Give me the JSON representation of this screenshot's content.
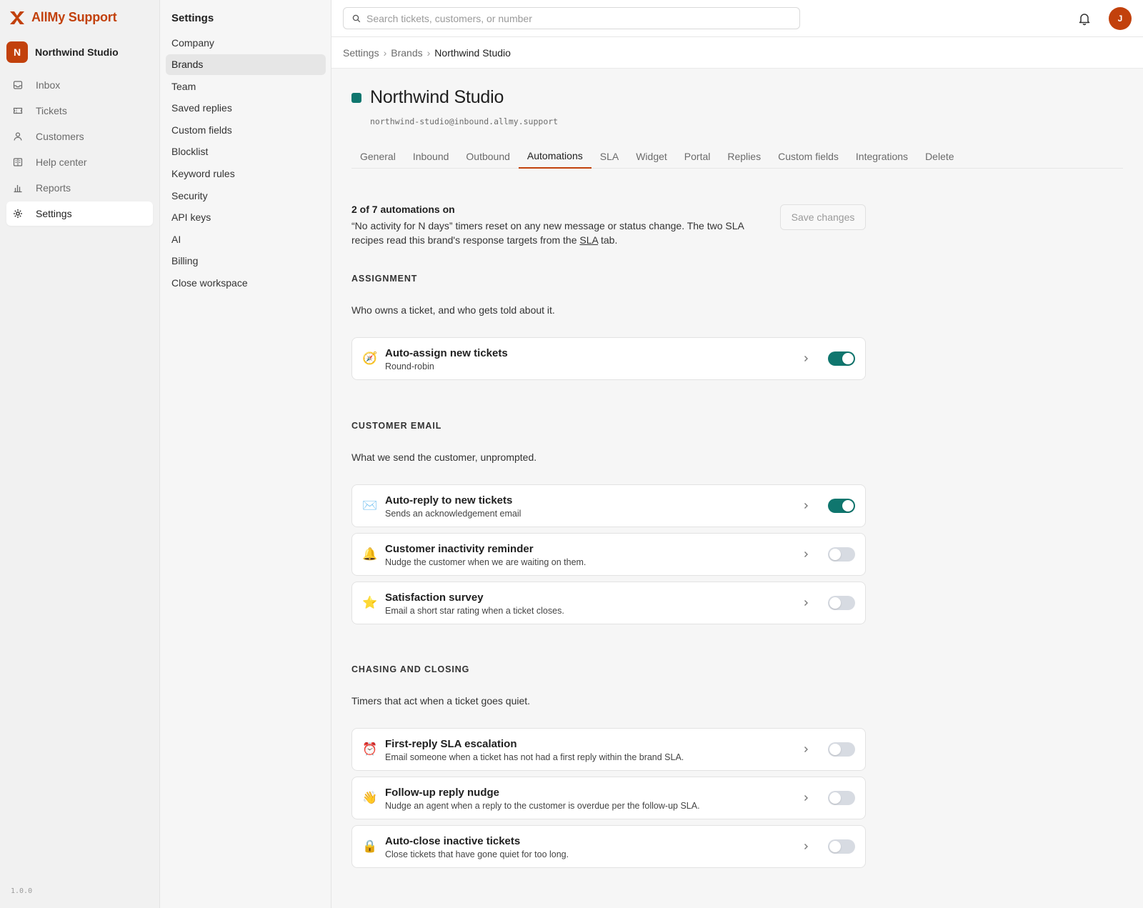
{
  "app": {
    "name": "AllMy Support",
    "version": "1.0.0",
    "brand_color": "#c2410c"
  },
  "workspace": {
    "initial": "N",
    "name": "Northwind Studio"
  },
  "nav": [
    {
      "label": "Inbox",
      "icon": "inbox-icon"
    },
    {
      "label": "Tickets",
      "icon": "ticket-icon"
    },
    {
      "label": "Customers",
      "icon": "user-icon"
    },
    {
      "label": "Help center",
      "icon": "book-icon"
    },
    {
      "label": "Reports",
      "icon": "bar-chart-icon"
    },
    {
      "label": "Settings",
      "icon": "gear-icon",
      "active": true
    }
  ],
  "settings_menu": {
    "title": "Settings",
    "items": [
      "Company",
      "Brands",
      "Team",
      "Saved replies",
      "Custom fields",
      "Blocklist",
      "Keyword rules",
      "Security",
      "API keys",
      "AI",
      "Billing",
      "Close workspace"
    ],
    "active": "Brands"
  },
  "search": {
    "placeholder": "Search tickets, customers, or number"
  },
  "user": {
    "initial": "J"
  },
  "breadcrumb": [
    "Settings",
    "Brands",
    "Northwind Studio"
  ],
  "brand": {
    "name": "Northwind Studio",
    "email": "northwind-studio@inbound.allmy.support",
    "color": "#0f766e"
  },
  "tabs": [
    "General",
    "Inbound",
    "Outbound",
    "Automations",
    "SLA",
    "Widget",
    "Portal",
    "Replies",
    "Custom fields",
    "Integrations",
    "Delete"
  ],
  "active_tab": "Automations",
  "summary": {
    "title": "2 of 7 automations on",
    "text_before": "“No activity for N days” timers reset on any new message or status change. The two SLA recipes read this brand's response targets from the ",
    "link": "SLA",
    "text_after": " tab.",
    "save_label": "Save changes"
  },
  "sections": [
    {
      "heading": "ASSIGNMENT",
      "description": "Who owns a ticket, and who gets told about it.",
      "items": [
        {
          "title": "Auto-assign new tickets",
          "subtitle": "Round-robin",
          "icon": "compass-icon",
          "glyph": "🧭",
          "on": true
        }
      ]
    },
    {
      "heading": "CUSTOMER EMAIL",
      "description": "What we send the customer, unprompted.",
      "items": [
        {
          "title": "Auto-reply to new tickets",
          "subtitle": "Sends an acknowledgement email",
          "icon": "envelope-icon",
          "glyph": "✉️",
          "on": true
        },
        {
          "title": "Customer inactivity reminder",
          "subtitle": "Nudge the customer when we are waiting on them.",
          "icon": "bell-icon",
          "glyph": "🔔",
          "on": false
        },
        {
          "title": "Satisfaction survey",
          "subtitle": "Email a short star rating when a ticket closes.",
          "icon": "star-icon",
          "glyph": "⭐",
          "on": false
        }
      ]
    },
    {
      "heading": "CHASING AND CLOSING",
      "description": "Timers that act when a ticket goes quiet.",
      "items": [
        {
          "title": "First-reply SLA escalation",
          "subtitle": "Email someone when a ticket has not had a first reply within the brand SLA.",
          "icon": "alarm-clock-icon",
          "glyph": "⏰",
          "on": false
        },
        {
          "title": "Follow-up reply nudge",
          "subtitle": "Nudge an agent when a reply to the customer is overdue per the follow-up SLA.",
          "icon": "waving-hand-icon",
          "glyph": "👋",
          "on": false
        },
        {
          "title": "Auto-close inactive tickets",
          "subtitle": "Close tickets that have gone quiet for too long.",
          "icon": "lock-icon",
          "glyph": "🔒",
          "on": false
        }
      ]
    }
  ]
}
